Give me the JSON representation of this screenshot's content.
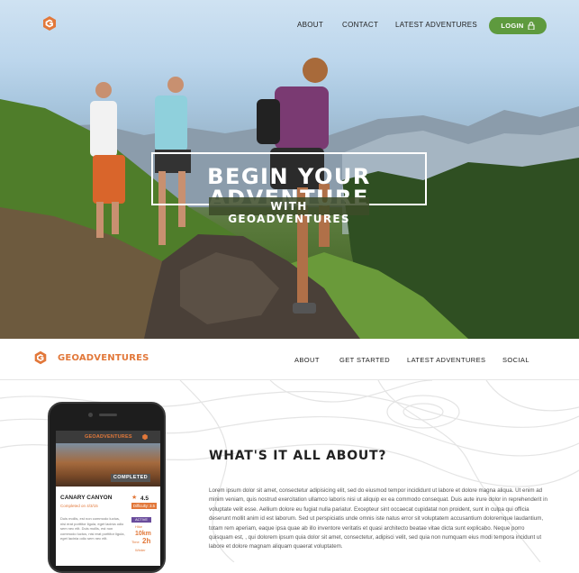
{
  "hero": {
    "nav": [
      "ABOUT",
      "CONTACT",
      "LATEST ADVENTURES"
    ],
    "login_label": "LOGIN",
    "title": "BEGIN YOUR ADVENTURE",
    "subtitle": "WITH GEOADVENTURES"
  },
  "navbar": {
    "brand": "GEOADVENTURES",
    "links": [
      "ABOUT",
      "GET STARTED",
      "LATEST ADVENTURES",
      "SOCIAL"
    ]
  },
  "section": {
    "title": "WHAT'S IT ALL ABOUT?",
    "body": "Lorem ipsum dolor sit amet, consectetur adipisicing elit, sed do eiusmod tempor incididunt ut labore et dolore magna aliqua. Ut enim ad minim veniam, quis nostrud exercitation ullamco laboris nisi ut aliquip ex ea commodo consequat. Duis aute irure dolor in reprehenderit in voluptate velit esse. Aellium dolore eu fugiat nulla pariatur. Excepteur sint occaecat cupidatat non proident, sunt in culpa qui officia deserunt mollit anim id est laborum. Sed ut perspiciatis unde omnis iste natus error sit voluptatem accusantium doloremque laudantium, totam rem aperiam, eaque ipsa quae ab illo inventore veritatis et quasi architecto beatae vitae dicta sunt explicabo. Neque porro quisquam est, , qui dolorem ipsum quia dolor sit amet, consectetur, adipisci velit, sed quia non numquam eius modi tempora incidunt ut labore et dolore magnam aliquam quaerat voluptatem."
  },
  "phone": {
    "app_brand": "GEOADVENTURES",
    "completed_label": "COMPLETED",
    "card_title": "CANARY CANYON",
    "rating": "4.5",
    "card_sub": "Completed on 4/3/15",
    "badge": "Difficulty: 3.5",
    "card_text": "Duis mollis, est non commodo luctus, nisi erat porttitor ligula, eget lacinia odio sem nec elit. Duis mollis, est non commodo luctus, nisi erat porttitor ligula, eget lacinia odio sem nec elit.",
    "pill": "ACTIVE",
    "stats": [
      {
        "label": "Hike",
        "value": "10km"
      },
      {
        "label": "Time",
        "value": "2h"
      },
      {
        "label": "Winter",
        "value": ""
      }
    ]
  },
  "colors": {
    "accent": "#e2783a",
    "login_green": "#5e9a3e"
  }
}
